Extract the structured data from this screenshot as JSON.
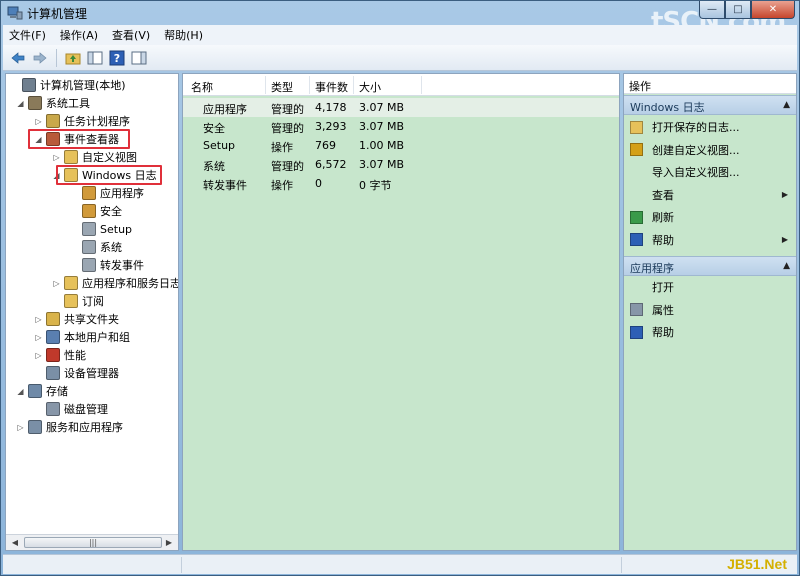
{
  "window": {
    "title": "计算机管理",
    "watermark_top": "tSCN.com",
    "watermark_bottom": "JB51.Net",
    "min_glyph": "—",
    "max_glyph": "□",
    "close_glyph": "✕"
  },
  "menubar": [
    {
      "label": "文件(F)"
    },
    {
      "label": "操作(A)"
    },
    {
      "label": "查看(V)"
    },
    {
      "label": "帮助(H)"
    }
  ],
  "tree": [
    {
      "label": "计算机管理(本地)",
      "icon": "computer-icon",
      "color": "#6f7f8f",
      "expander": "",
      "level": 0
    },
    {
      "label": "系统工具",
      "icon": "tools-icon",
      "color": "#8a7a5a",
      "expander": "◢",
      "level": 1
    },
    {
      "label": "任务计划程序",
      "icon": "clock-icon",
      "color": "#c9a84a",
      "expander": "▷",
      "level": 2
    },
    {
      "label": "事件查看器",
      "icon": "event-viewer-icon",
      "color": "#b85a3a",
      "expander": "◢",
      "level": 2
    },
    {
      "label": "自定义视图",
      "icon": "folder-icon",
      "color": "#e6c15a",
      "expander": "▷",
      "level": 3
    },
    {
      "label": "Windows 日志",
      "icon": "log-folder-icon",
      "color": "#e6c15a",
      "expander": "◢",
      "level": 3
    },
    {
      "label": "应用程序",
      "icon": "log-icon",
      "color": "#d19a3a",
      "expander": "",
      "level": 4
    },
    {
      "label": "安全",
      "icon": "log-icon",
      "color": "#d19a3a",
      "expander": "",
      "level": 4
    },
    {
      "label": "Setup",
      "icon": "log-icon",
      "color": "#9aa6b2",
      "expander": "",
      "level": 4
    },
    {
      "label": "系统",
      "icon": "log-icon",
      "color": "#9aa6b2",
      "expander": "",
      "level": 4
    },
    {
      "label": "转发事件",
      "icon": "log-icon",
      "color": "#9aa6b2",
      "expander": "",
      "level": 4
    },
    {
      "label": "应用程序和服务日志",
      "icon": "folder-icon",
      "color": "#e6c15a",
      "expander": "▷",
      "level": 3
    },
    {
      "label": "订阅",
      "icon": "subscription-icon",
      "color": "#e6c15a",
      "expander": "",
      "level": 3
    },
    {
      "label": "共享文件夹",
      "icon": "shared-folder-icon",
      "color": "#d9b34a",
      "expander": "▷",
      "level": 2
    },
    {
      "label": "本地用户和组",
      "icon": "users-icon",
      "color": "#5a7fb0",
      "expander": "▷",
      "level": 2
    },
    {
      "label": "性能",
      "icon": "performance-icon",
      "color": "#c0392b",
      "expander": "▷",
      "level": 2
    },
    {
      "label": "设备管理器",
      "icon": "device-manager-icon",
      "color": "#7a8fa6",
      "expander": "",
      "level": 2
    },
    {
      "label": "存储",
      "icon": "storage-icon",
      "color": "#6f8aa8",
      "expander": "◢",
      "level": 1
    },
    {
      "label": "磁盘管理",
      "icon": "disk-icon",
      "color": "#8796a8",
      "expander": "",
      "level": 2
    },
    {
      "label": "服务和应用程序",
      "icon": "services-icon",
      "color": "#7a8fa6",
      "expander": "▷",
      "level": 1
    }
  ],
  "table": {
    "columns": [
      "名称",
      "类型",
      "事件数",
      "大小"
    ],
    "rows": [
      [
        "应用程序",
        "管理的",
        "4,178",
        "3.07 MB"
      ],
      [
        "安全",
        "管理的",
        "3,293",
        "3.07 MB"
      ],
      [
        "Setup",
        "操作",
        "769",
        "1.00 MB"
      ],
      [
        "系统",
        "管理的",
        "6,572",
        "3.07 MB"
      ],
      [
        "转发事件",
        "操作",
        "0",
        "0 字节"
      ]
    ]
  },
  "actions": {
    "header": "操作",
    "section1": "Windows 日志",
    "items1": [
      {
        "label": "打开保存的日志...",
        "icon": "open-log-icon",
        "color": "#e6c15a",
        "submenu": false
      },
      {
        "label": "创建自定义视图...",
        "icon": "filter-icon",
        "color": "#d4a017",
        "submenu": false
      },
      {
        "label": "导入自定义视图...",
        "icon": "",
        "color": "",
        "submenu": false
      },
      {
        "label": "查看",
        "icon": "",
        "color": "",
        "submenu": true
      },
      {
        "label": "刷新",
        "icon": "refresh-icon",
        "color": "#3a9a4a",
        "submenu": false
      },
      {
        "label": "帮助",
        "icon": "help-icon",
        "color": "#2d5fb5",
        "submenu": true
      }
    ],
    "section2": "应用程序",
    "items2": [
      {
        "label": "打开",
        "icon": "",
        "color": "",
        "submenu": false
      },
      {
        "label": "属性",
        "icon": "properties-icon",
        "color": "#8796a8",
        "submenu": false
      },
      {
        "label": "帮助",
        "icon": "help-icon",
        "color": "#2d5fb5",
        "submenu": false
      }
    ],
    "arrow_glyph": "▶",
    "collapse_glyph": "▲"
  }
}
